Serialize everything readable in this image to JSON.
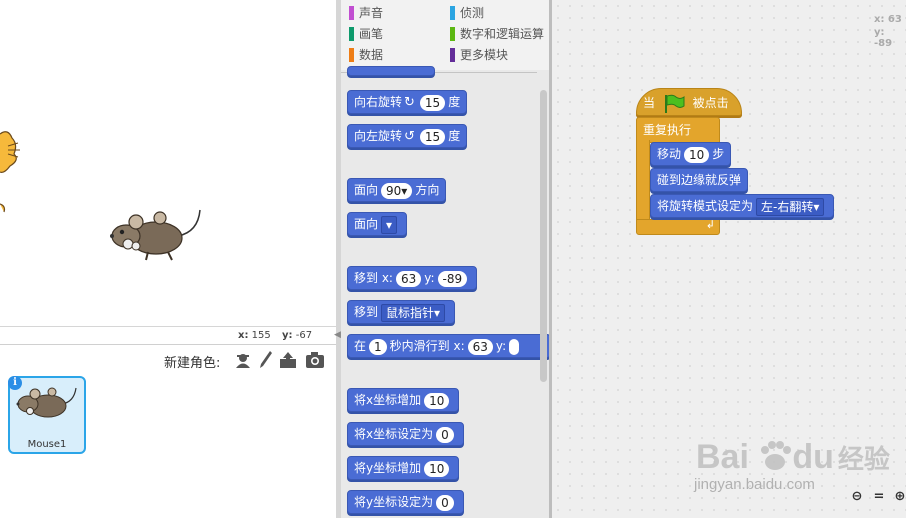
{
  "stage": {
    "coords": {
      "x_label": "x:",
      "x_value": "155",
      "y_label": "y:",
      "y_value": "-67"
    }
  },
  "sprite_bar": {
    "new_sprite_label": "新建角色:"
  },
  "sprites": [
    {
      "name": "Mouse1"
    }
  ],
  "categories": [
    {
      "label": "声音",
      "color": "#c14fd1"
    },
    {
      "label": "侦测",
      "color": "#2ca5e2"
    },
    {
      "label": "画笔",
      "color": "#0e9a6c"
    },
    {
      "label": "数字和逻辑运算",
      "color": "#5cb712"
    },
    {
      "label": "数据",
      "color": "#ee7d16"
    },
    {
      "label": "更多模块",
      "color": "#632d99"
    }
  ],
  "palette": {
    "turn_right": {
      "label": "向右旋转",
      "value": "15",
      "unit": "度"
    },
    "turn_left": {
      "label": "向左旋转",
      "value": "15",
      "unit": "度"
    },
    "point_direction": {
      "label": "面向",
      "value": "90▾",
      "unit": "方向"
    },
    "point_towards": {
      "label": "面向",
      "value": "▾"
    },
    "goto_xy": {
      "label": "移到 x:",
      "x": "63",
      "y_label": "y:",
      "y": "-89"
    },
    "goto_target": {
      "label": "移到",
      "value": "鼠标指针▾"
    },
    "glide": {
      "label1": "在",
      "secs": "1",
      "label2": "秒内滑行到 x:",
      "x": "63",
      "y_label": "y:"
    },
    "change_x": {
      "label": "将x坐标增加",
      "value": "10"
    },
    "set_x": {
      "label": "将x坐标设定为",
      "value": "0"
    },
    "change_y": {
      "label": "将y坐标增加",
      "value": "10"
    },
    "set_y": {
      "label": "将y坐标设定为",
      "value": "0"
    }
  },
  "script": {
    "hat": {
      "label1": "当",
      "label2": "被点击"
    },
    "forever": {
      "label": "重复执行"
    },
    "move": {
      "label": "移动",
      "value": "10",
      "unit": "步"
    },
    "bounce": {
      "label": "碰到边缘就反弹"
    },
    "rotation_style": {
      "label": "将旋转模式设定为",
      "value": "左-右翻转▾"
    }
  },
  "scripts_area": {
    "mouse_x": "x: 63",
    "mouse_y": "y: -89"
  },
  "watermark": {
    "brand": "Bai",
    "brand2": "du",
    "cn": "经验",
    "url": "jingyan.baidu.com"
  }
}
